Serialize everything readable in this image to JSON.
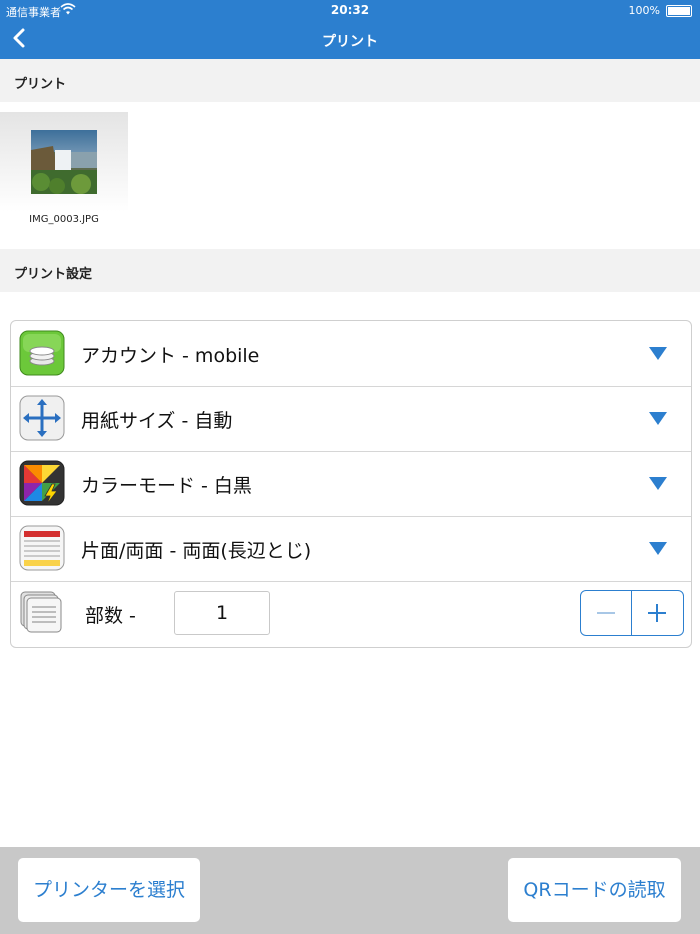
{
  "status_bar": {
    "carrier": "通信事業者",
    "time": "20:32",
    "battery": "100%"
  },
  "nav": {
    "title": "プリント",
    "back_icon": "chevron-left-icon"
  },
  "section_print": {
    "title": "プリント"
  },
  "file": {
    "name": "IMG_0003.JPG"
  },
  "section_settings": {
    "title": "プリント設定"
  },
  "settings": {
    "account": {
      "label": "アカウント - mobile",
      "icon": "account-icon"
    },
    "paper_size": {
      "label": "用紙サイズ - 自動",
      "icon": "paper-size-icon"
    },
    "color_mode": {
      "label": "カラーモード - 白黒",
      "icon": "color-mode-icon"
    },
    "duplex": {
      "label": "片面/両面 - 両面(長辺とじ)",
      "icon": "duplex-icon"
    },
    "copies": {
      "label": "部数 -",
      "value": "1",
      "icon": "copies-icon"
    }
  },
  "colors": {
    "accent": "#2c7fcf",
    "section_bg": "#f2f2f2",
    "bottom_bar": "#c8c8c8"
  },
  "bottom": {
    "select_printer": "プリンターを選択",
    "read_qr": "QRコードの読取"
  }
}
